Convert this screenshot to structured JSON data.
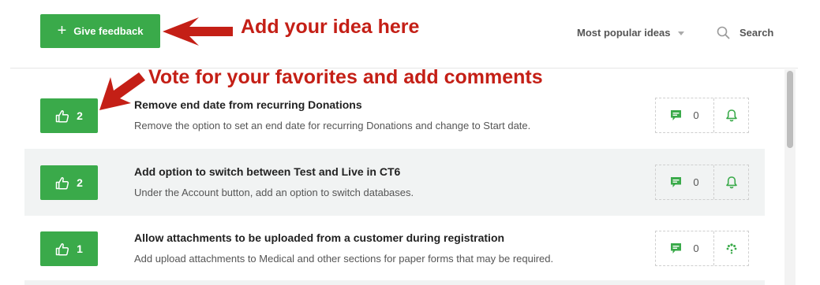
{
  "toolbar": {
    "feedback_label": "Give feedback",
    "sort_label": "Most popular ideas",
    "search_label": "Search"
  },
  "annotations": {
    "add_idea": "Add your idea here",
    "vote": "Vote for your favorites and add comments"
  },
  "colors": {
    "accent_green": "#3aaa4a",
    "callout_red": "#c41f16",
    "row_alt_bg": "#f1f3f3"
  },
  "ideas": [
    {
      "votes": "2",
      "title": "Remove end date from recurring Donations",
      "description": "Remove the option to set an end date for recurring Donations and change to Start date.",
      "comments": "0",
      "status_icon": "bell-icon"
    },
    {
      "votes": "2",
      "title": "Add option to switch between Test and Live in CT6",
      "description": "Under the Account button, add an option to switch databases.",
      "comments": "0",
      "status_icon": "bell-icon"
    },
    {
      "votes": "1",
      "title": "Allow attachments to be uploaded from a customer during registration",
      "description": "Add upload attachments to Medical and other sections for paper forms that may be required.",
      "comments": "0",
      "status_icon": "loading-icon"
    }
  ]
}
